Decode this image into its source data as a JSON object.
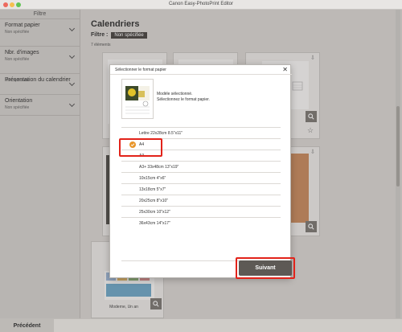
{
  "window": {
    "title": "Canon Easy-PhotoPrint Editor"
  },
  "sidebar": {
    "header": "Filtre",
    "filters": [
      {
        "label": "Format papier",
        "value": "Non spécifiée"
      },
      {
        "label": "Nbr. d'images",
        "value": "Non spécifiée"
      },
      {
        "label": "Présentation du calendrier",
        "value": "Non spécifiée"
      },
      {
        "label": "Orientation",
        "value": "Non spécifiée"
      }
    ]
  },
  "main": {
    "title": "Calendriers",
    "filter_label": "Filtre :",
    "filter_chip": "Non spécifiée",
    "count": "7 éléments",
    "card_labels": {
      "bottom_left": "Moderne, Un an"
    }
  },
  "dialog": {
    "title": "Sélectionner le format papier",
    "message_line1": "Modèle sélectionné.",
    "message_line2": "Sélectionnez le format papier.",
    "sizes": [
      "Lettre 22x28cm 8.5\"x11\"",
      "A4",
      "A3",
      "A3+ 33x48cm 13\"x19\"",
      "10x15cm 4\"x6\"",
      "13x18cm 5\"x7\"",
      "20x25cm 8\"x10\"",
      "25x30cm 10\"x12\"",
      "36x43cm 14\"x17\""
    ],
    "selected_index": 1,
    "next_label": "Suivant",
    "close_label": "✕"
  },
  "footer": {
    "prev_label": "Précédent"
  },
  "colors": {
    "accent": "#e8962b",
    "highlight": "#e2231a",
    "button_dark": "#5d5955"
  }
}
